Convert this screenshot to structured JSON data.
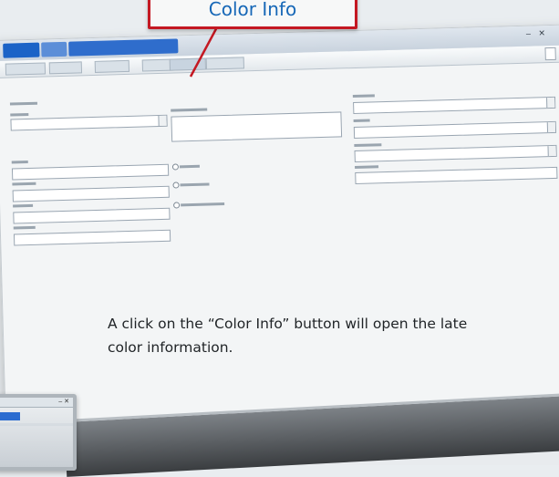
{
  "callout": {
    "label": "Color Info"
  },
  "caption": {
    "line1": "A click on the “Color Info” button will open the late",
    "line2": "color information."
  },
  "titlebar": {
    "controls": "– ✕"
  },
  "monitor2": {
    "controls": "– ✕"
  },
  "colors": {
    "accent_blue": "#1b63c7",
    "callout_border": "#c41822",
    "callout_text": "#1667b7"
  }
}
